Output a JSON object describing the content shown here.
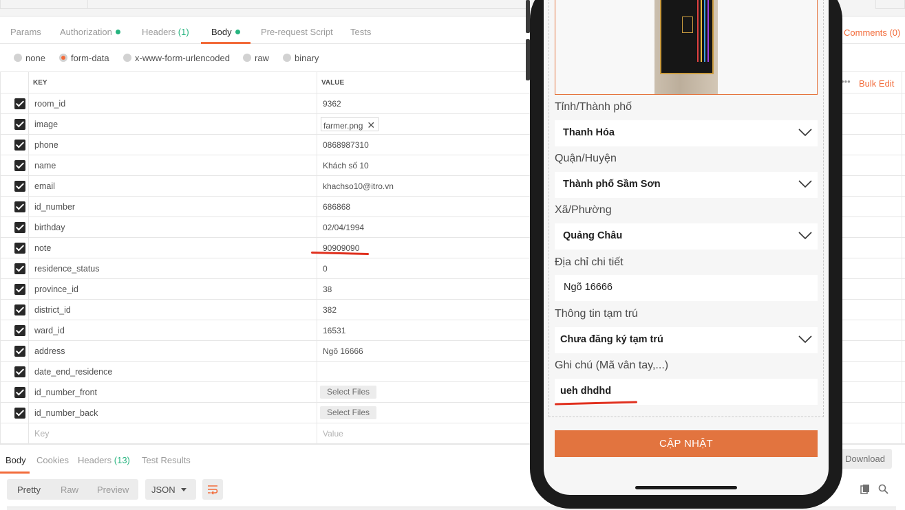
{
  "request_tabs": {
    "params": "Params",
    "authorization": "Authorization",
    "headers": "Headers",
    "headers_count": "(1)",
    "body": "Body",
    "prerequest": "Pre-request Script",
    "tests": "Tests",
    "comments": "Comments (0)"
  },
  "body_types": {
    "none": "none",
    "form_data": "form-data",
    "urlencoded": "x-www-form-urlencoded",
    "raw": "raw",
    "binary": "binary",
    "selected": "form-data"
  },
  "table": {
    "key_header": "KEY",
    "value_header": "VALUE",
    "bulk_edit": "Bulk Edit",
    "more": "•••",
    "rows": [
      {
        "key": "room_id",
        "value": "9362"
      },
      {
        "key": "image",
        "value": "farmer.png"
      },
      {
        "key": "phone",
        "value": "0868987310"
      },
      {
        "key": "name",
        "value": "Khách số 10"
      },
      {
        "key": "email",
        "value": "khachso10@itro.vn"
      },
      {
        "key": "id_number",
        "value": "686868"
      },
      {
        "key": "birthday",
        "value": "02/04/1994"
      },
      {
        "key": "note",
        "value": "90909090"
      },
      {
        "key": "residence_status",
        "value": "0"
      },
      {
        "key": "province_id",
        "value": "38"
      },
      {
        "key": "district_id",
        "value": "382"
      },
      {
        "key": "ward_id",
        "value": "16531"
      },
      {
        "key": "address",
        "value": "Ngõ 16666"
      },
      {
        "key": "date_end_residence",
        "value": ""
      },
      {
        "key": "id_number_front",
        "value": "Select Files"
      },
      {
        "key": "id_number_back",
        "value": "Select Files"
      }
    ],
    "placeholder_key": "Key",
    "placeholder_value": "Value"
  },
  "response": {
    "tabs": {
      "body": "Body",
      "cookies": "Cookies",
      "headers": "Headers",
      "headers_count": "(13)",
      "test_results": "Test Results"
    },
    "download": "Download",
    "views": {
      "pretty": "Pretty",
      "raw": "Raw",
      "preview": "Preview"
    },
    "format": "JSON"
  },
  "phone_form": {
    "province_label": "Tỉnh/Thành phố",
    "province_value": "Thanh Hóa",
    "district_label": "Quận/Huyện",
    "district_value": "Thành phố Sầm Sơn",
    "ward_label": "Xã/Phường",
    "ward_value": "Quảng Châu",
    "address_label": "Địa chỉ chi tiết",
    "address_value": "Ngõ 16666",
    "residence_label": "Thông tin tạm trú",
    "residence_value": "Chưa đăng ký tạm trú",
    "note_label": "Ghi chú (Mã vân tay,...)",
    "note_value": "ueh dhdhd",
    "update_button": "CẬP NHẬT"
  },
  "colors": {
    "accent": "#f26b3a",
    "status_green": "#26b47f",
    "update_button": "#e2743f",
    "annotation_red": "#e0301e"
  }
}
